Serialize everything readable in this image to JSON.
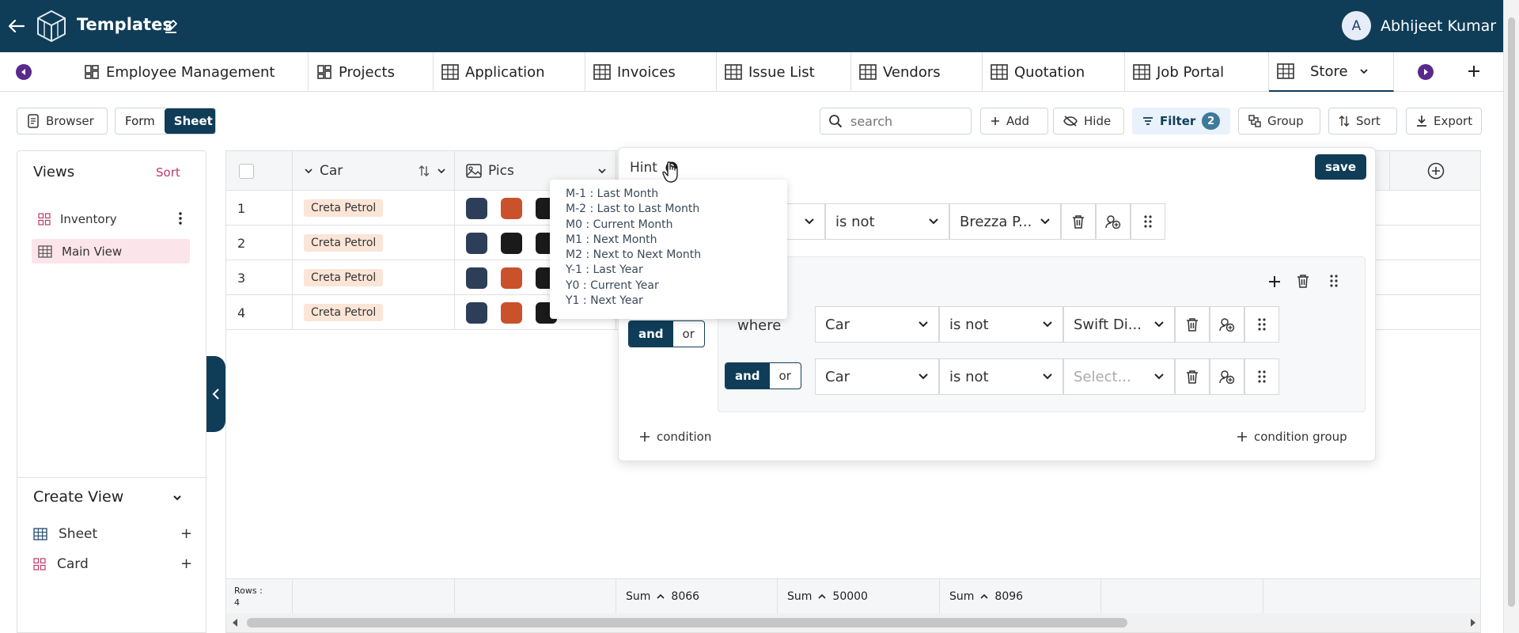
{
  "header": {
    "title": "Templates",
    "user_initial": "A",
    "user_name": "Abhijeet Kumar",
    "bg_color": "#0f3d58"
  },
  "tabs": [
    {
      "label": "Employee Management",
      "icon": "dashboard-icon"
    },
    {
      "label": "Projects",
      "icon": "dashboard-icon"
    },
    {
      "label": "Application",
      "icon": "table-icon"
    },
    {
      "label": "Invoices",
      "icon": "table-icon"
    },
    {
      "label": "Issue List",
      "icon": "table-icon"
    },
    {
      "label": "Vendors",
      "icon": "table-icon"
    },
    {
      "label": "Quotation",
      "icon": "table-icon"
    },
    {
      "label": "Job Portal",
      "icon": "table-icon"
    },
    {
      "label": "Store",
      "icon": "table-icon",
      "active": true
    }
  ],
  "toolbar": {
    "browser": "Browser",
    "form": "Form",
    "sheet": "Sheet",
    "search_placeholder": "search",
    "add": "Add",
    "hide": "Hide",
    "filter": "Filter",
    "filter_count": "2",
    "group": "Group",
    "sort": "Sort",
    "export": "Export"
  },
  "sidebar": {
    "views_title": "Views",
    "sort": "Sort",
    "views": [
      {
        "label": "Inventory",
        "icon": "card-grid-icon"
      },
      {
        "label": "Main View",
        "icon": "table-icon",
        "selected": true
      }
    ],
    "create_title": "Create View",
    "create_items": [
      {
        "label": "Sheet",
        "icon": "table-icon"
      },
      {
        "label": "Card",
        "icon": "card-grid-icon"
      }
    ]
  },
  "grid": {
    "columns": [
      {
        "label": "Car"
      },
      {
        "label": "Pics"
      }
    ],
    "rows": [
      {
        "num": "1",
        "car": "Creta Petrol"
      },
      {
        "num": "2",
        "car": "Creta Petrol"
      },
      {
        "num": "3",
        "car": "Creta Petrol"
      },
      {
        "num": "4",
        "car": "Creta Petrol"
      }
    ],
    "footer": {
      "rows_label": "Rows :",
      "rows_count": "4",
      "sums": [
        {
          "label": "Sum",
          "value": "8066"
        },
        {
          "label": "Sum",
          "value": "50000"
        },
        {
          "label": "Sum",
          "value": "8096"
        }
      ]
    }
  },
  "filter_panel": {
    "hint_label": "Hint",
    "save": "save",
    "top_condition": {
      "operator": "is not",
      "value": "Brezza P..."
    },
    "group_and": "and",
    "group_or": "or",
    "conditions": [
      {
        "prefix": "where",
        "field": "Car",
        "operator": "is not",
        "value": "Swift Di...",
        "placeholder": false
      },
      {
        "and": "and",
        "or": "or",
        "field": "Car",
        "operator": "is not",
        "value": "Select...",
        "placeholder": true
      }
    ],
    "add_condition": "condition",
    "add_condition_group": "condition group"
  },
  "hint_popup": {
    "lines": [
      "M-1 : Last Month",
      "M-2 : Last to Last Month",
      "M0 : Current Month",
      "M1 : Next Month",
      "M2 : Next to Next Month",
      "Y-1 : Last Year",
      "Y0 : Current Year",
      "Y1 : Next Year"
    ]
  }
}
